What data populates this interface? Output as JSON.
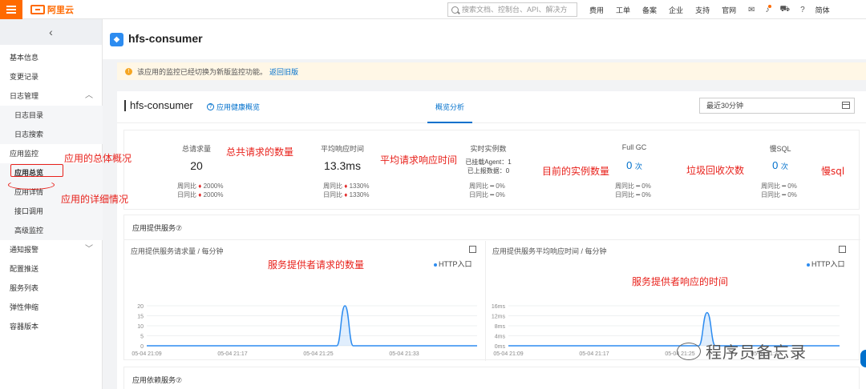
{
  "topbar": {
    "logo_text": "阿里云",
    "search_placeholder": "搜索文档、控制台、API、解决方",
    "nav": [
      "费用",
      "工单",
      "备案",
      "企业",
      "支持",
      "官网"
    ],
    "lang": "简体"
  },
  "sidebar": {
    "collapse": "‹",
    "items": [
      {
        "label": "基本信息"
      },
      {
        "label": "变更记录"
      },
      {
        "label": "日志管理",
        "chevron": "^"
      },
      {
        "label": "日志目录"
      },
      {
        "label": "日志搜索"
      },
      {
        "label": "应用监控"
      },
      {
        "label": "应用总览"
      },
      {
        "label": "应用详情"
      },
      {
        "label": "接口调用"
      },
      {
        "label": "高级监控"
      },
      {
        "label": "通知报警",
        "chevron": "v"
      },
      {
        "label": "配置推送"
      },
      {
        "label": "服务列表"
      },
      {
        "label": "弹性伸缩"
      },
      {
        "label": "容器版本"
      }
    ]
  },
  "app": {
    "title": "hfs-consumer",
    "notice": "该应用的监控已经切换为新版监控功能。",
    "notice_link": "返回旧版"
  },
  "panel": {
    "title": "hfs-consumer",
    "health_link": "应用健康概览",
    "tab": "概览分析",
    "time_range": "最近30分钟"
  },
  "metrics": {
    "requests": {
      "label": "总请求量",
      "value": "20",
      "wow_label": "周同比",
      "wow": "2000%",
      "dod_label": "日同比",
      "dod": "2000%"
    },
    "rt": {
      "label": "平均响应时间",
      "value": "13.3ms",
      "wow_label": "周同比",
      "wow": "1330%",
      "dod_label": "日同比",
      "dod": "1330%"
    },
    "instances": {
      "label": "实时实例数",
      "agents": "已挂载Agent：1",
      "reported": "已上报数据：0",
      "wow_label": "周同比",
      "wow": "0%",
      "dod_label": "日同比",
      "dod": "0%"
    },
    "fullgc": {
      "label": "Full GC",
      "value": "0",
      "unit": "次",
      "wow_label": "周同比",
      "wow": "0%",
      "dod_label": "日同比",
      "dod": "0%"
    },
    "slowsql": {
      "label": "慢SQL",
      "value": "0",
      "unit": "次",
      "wow_label": "周同比",
      "wow": "0%",
      "dod_label": "日同比",
      "dod": "0%"
    }
  },
  "service": {
    "title": "应用提供服务⑦",
    "deps_title": "应用依赖服务⑦"
  },
  "chart_data": [
    {
      "type": "line",
      "title": "应用提供服务请求量 / 每分钟",
      "legend": "HTTP入口",
      "y_ticks": [
        "0",
        "5",
        "10",
        "15",
        "20"
      ],
      "x_ticks": [
        "05-04 21:09",
        "05-04 21:17",
        "05-04 21:25",
        "05-04 21:33"
      ],
      "ylim": [
        0,
        20
      ],
      "series": [
        {
          "name": "HTTP入口",
          "values": [
            0,
            0,
            0,
            0,
            0,
            0,
            0,
            0,
            0,
            0,
            0,
            0,
            0,
            0,
            0,
            0,
            0,
            0,
            0,
            0,
            0,
            0,
            0,
            0,
            20,
            0,
            0,
            0,
            0,
            0,
            0,
            0,
            0,
            0,
            0,
            0,
            0,
            0,
            0,
            0,
            0
          ]
        }
      ],
      "color": "#2d8cf0"
    },
    {
      "type": "line",
      "title": "应用提供服务平均响应时间 / 每分钟",
      "legend": "HTTP入口",
      "y_ticks": [
        "0ms",
        "4ms",
        "8ms",
        "12ms",
        "16ms"
      ],
      "x_ticks": [
        "05-04 21:09",
        "05-04 21:17",
        "05-04 21:25",
        "05-04 21:33"
      ],
      "ylim": [
        0,
        16
      ],
      "series": [
        {
          "name": "HTTP入口",
          "values": [
            0,
            0,
            0,
            0,
            0,
            0,
            0,
            0,
            0,
            0,
            0,
            0,
            0,
            0,
            0,
            0,
            0,
            0,
            0,
            0,
            0,
            0,
            0,
            0,
            13.3,
            0,
            0,
            0,
            0,
            0,
            0,
            0,
            0,
            0,
            0,
            0,
            0,
            0,
            0,
            0,
            0
          ]
        }
      ],
      "color": "#2d8cf0"
    }
  ],
  "annotations": {
    "overview": "应用的总体概况",
    "detail": "应用的详细情况",
    "total_req": "总共请求的数量",
    "avg_rt": "平均请求响应时间",
    "instances": "目前的实例数量",
    "gc": "垃圾回收次数",
    "slowsql": "慢sql",
    "chart1": "服务提供者请求的数量",
    "chart2": "服务提供者响应的时间"
  },
  "watermark": "程序员备忘录"
}
